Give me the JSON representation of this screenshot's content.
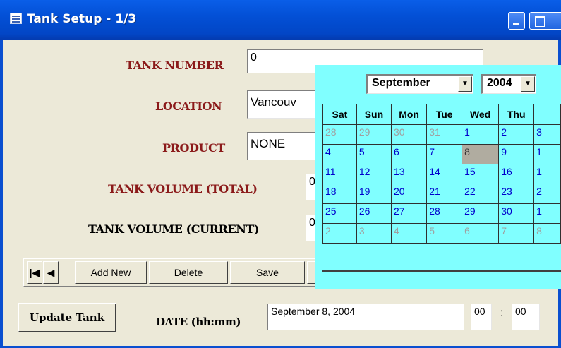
{
  "window": {
    "title": "Tank Setup - 1/3"
  },
  "form": {
    "tank_number": {
      "label": "TANK NUMBER",
      "value": "0"
    },
    "location": {
      "label": "LOCATION",
      "value": "Vancouv"
    },
    "product": {
      "label": "PRODUCT",
      "value": "NONE"
    },
    "volume_total": {
      "label": "TANK VOLUME (TOTAL)",
      "value": "0"
    },
    "volume_current": {
      "label": "TANK VOLUME (CURRENT)",
      "value": "0"
    }
  },
  "nav": {
    "first_icon": "first-record-icon",
    "prev_icon": "previous-record-icon",
    "first_glyph": "|◀",
    "prev_glyph": "◀",
    "add_new": "Add New",
    "delete": "Delete",
    "save": "Save"
  },
  "bottom": {
    "update_button": "Update Tank",
    "date_label": "DATE (hh:mm)",
    "date_value": "September 8, 2004",
    "hour": "00",
    "minute": "00",
    "separator": ":"
  },
  "calendar": {
    "month": "September",
    "year": "2004",
    "dropdown_glyph": "▼",
    "weekdays": [
      "Sat",
      "Sun",
      "Mon",
      "Tue",
      "Wed",
      "Thu",
      ""
    ],
    "weeks": [
      [
        "28",
        "29",
        "30",
        "31",
        "1",
        "2",
        "3"
      ],
      [
        "4",
        "5",
        "6",
        "7",
        "8",
        "9",
        "1"
      ],
      [
        "11",
        "12",
        "13",
        "14",
        "15",
        "16",
        "1"
      ],
      [
        "18",
        "19",
        "20",
        "21",
        "22",
        "23",
        "2"
      ],
      [
        "25",
        "26",
        "27",
        "28",
        "29",
        "30",
        "1"
      ],
      [
        "2",
        "3",
        "4",
        "5",
        "6",
        "7",
        "8"
      ]
    ],
    "other_month_rows": [
      0,
      5
    ],
    "other_month_cells_row0": [
      0,
      1,
      2,
      3
    ],
    "selected_day": "8"
  },
  "colors": {
    "titlebar": "#0350d6",
    "label_red": "#8b1a1a",
    "calendar_bg": "#80ffff",
    "day_text": "#0000cc",
    "other_month_text": "#a0a0a0",
    "selected_bg": "#b0aca0"
  }
}
